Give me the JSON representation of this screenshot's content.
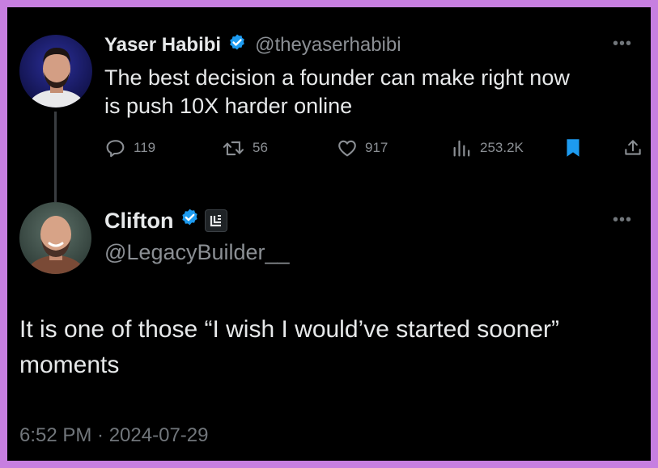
{
  "colors": {
    "border": "#c77fe0",
    "background": "#000000",
    "text": "#e7e9ea",
    "secondary": "#8b8f94",
    "verified": "#1d9bf0",
    "bookmark_active": "#1d9bf0"
  },
  "original_tweet": {
    "author_name": "Yaser Habibi",
    "handle": "@theyaserhabibi",
    "text_line_1": "The best decision a founder can make right now",
    "text_line_2": "is push 10X harder online",
    "stats": {
      "replies": "119",
      "retweets": "56",
      "likes": "917",
      "views": "253.2K"
    },
    "icons": [
      "reply-icon",
      "retweet-icon",
      "like-icon",
      "views-icon",
      "bookmark-icon",
      "share-icon"
    ]
  },
  "reply_tweet": {
    "author_name": "Clifton",
    "handle": "@LegacyBuilder__",
    "text_line_1": "It is one of those “I wish I would’ve started sooner”",
    "text_line_2": "moments",
    "timestamp": "6:52 PM · 2024-07-29"
  }
}
